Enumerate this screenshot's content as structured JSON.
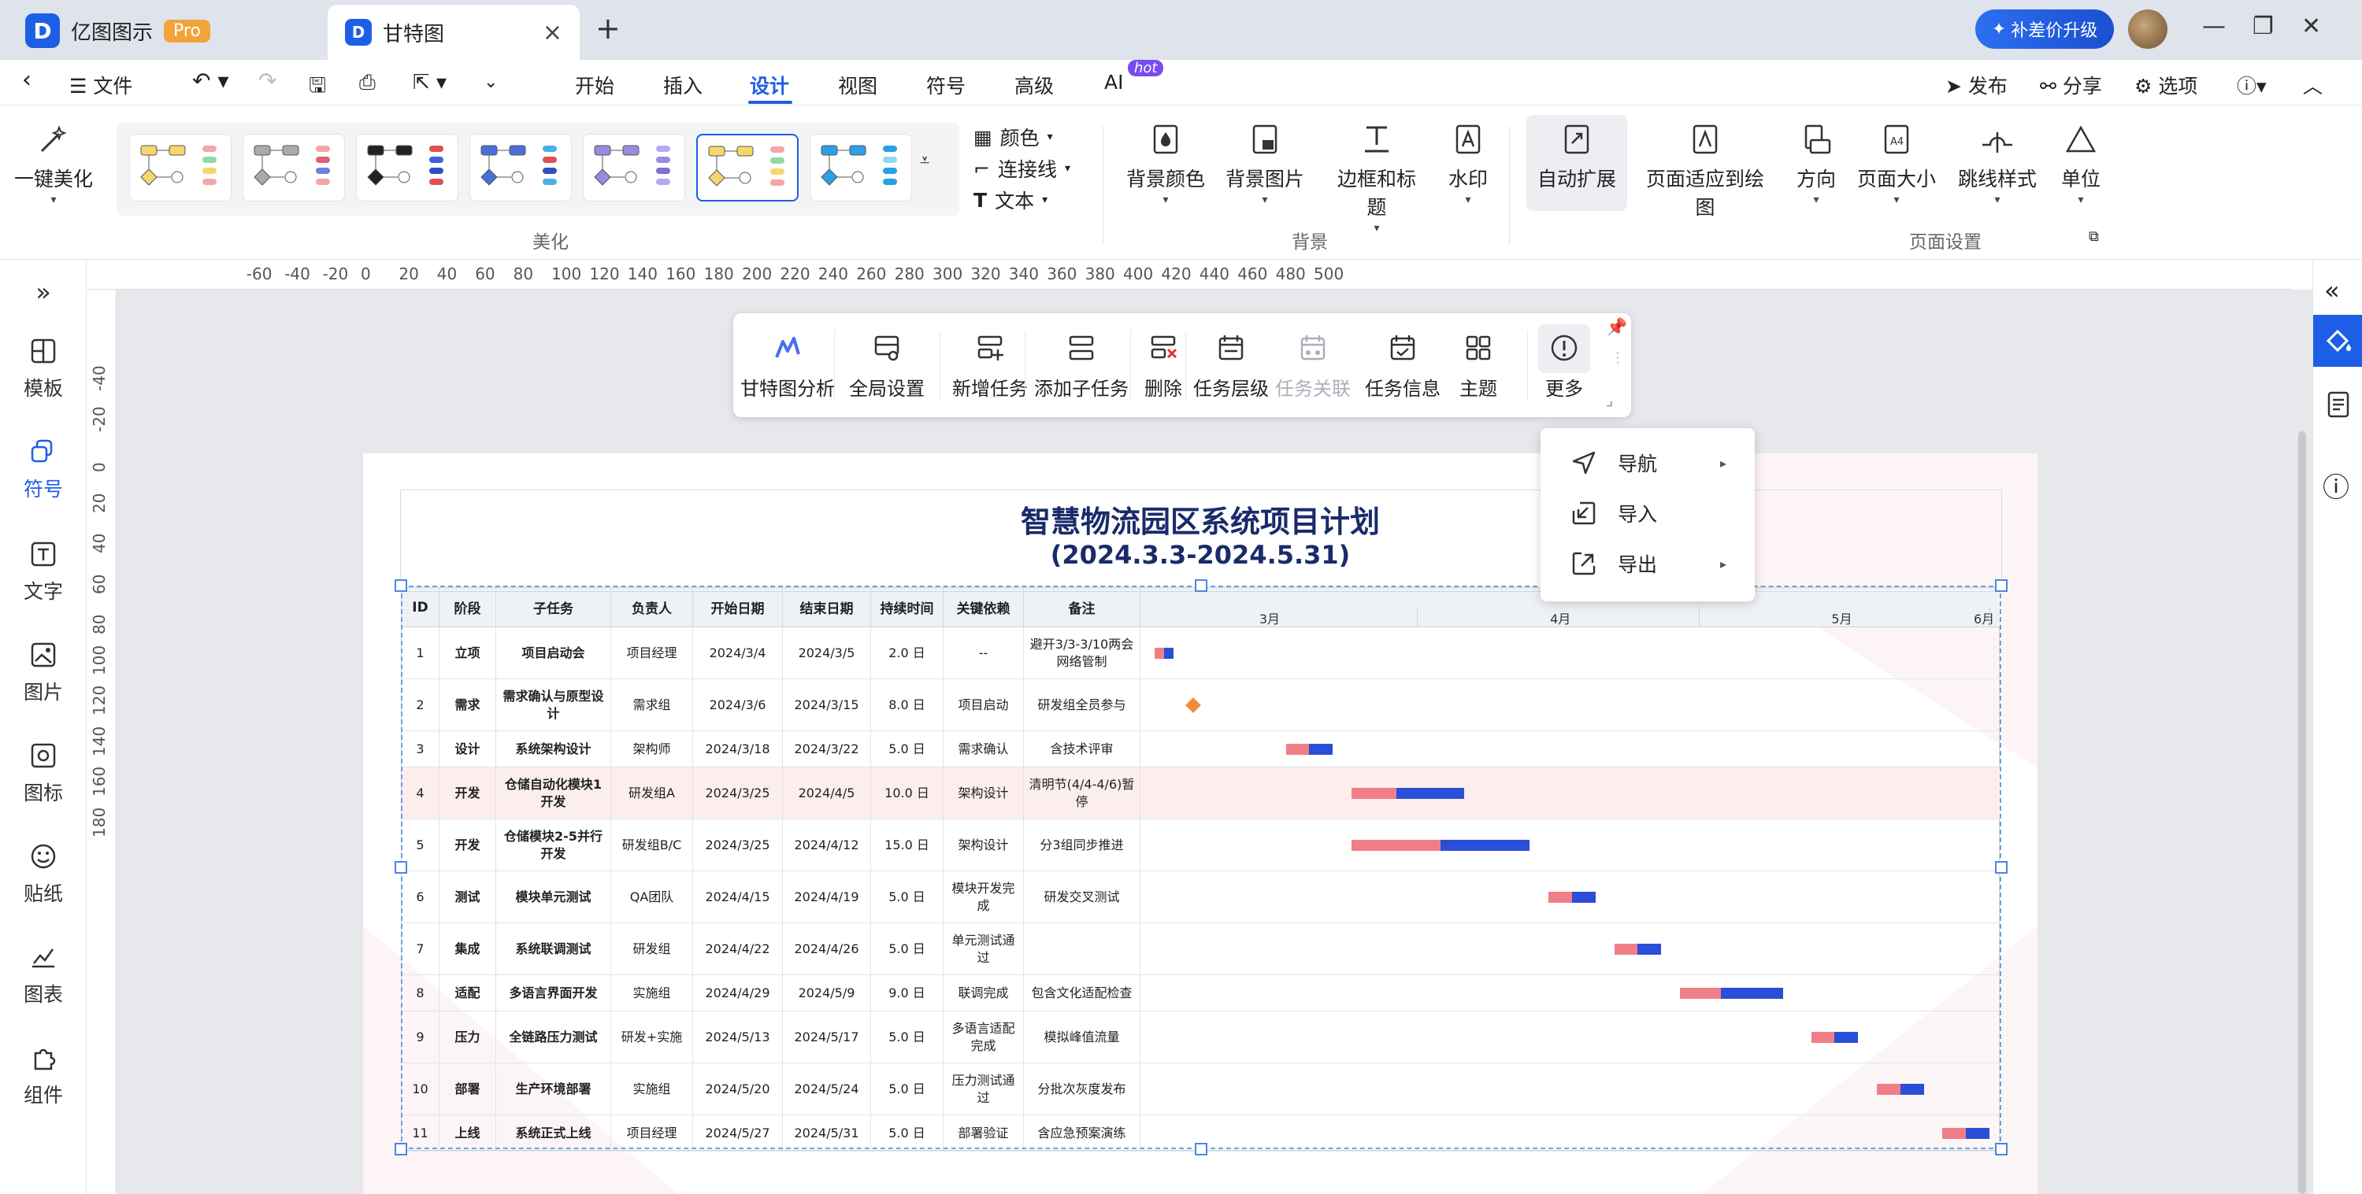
{
  "titlebar": {
    "app_name": "亿图图示",
    "pro_badge": "Pro",
    "doc_tab": "甘特图",
    "upgrade": "补差价升级"
  },
  "menubar": {
    "file": "文件",
    "items": [
      "开始",
      "插入",
      "设计",
      "视图",
      "符号",
      "高级",
      "AI"
    ],
    "active": "设计",
    "hot": "hot",
    "publish": "发布",
    "share": "分享",
    "options": "选项"
  },
  "ribbon": {
    "beautify": "一键美化",
    "group_beautify": "美化",
    "color": "颜色",
    "connector": "连接线",
    "text": "文本",
    "bg_color": "背景颜色",
    "bg_image": "背景图片",
    "border_title": "边框和标题",
    "watermark": "水印",
    "group_background": "背景",
    "auto_expand": "自动扩展",
    "fit_page": "页面适应到绘图",
    "orientation": "方向",
    "page_size": "页面大小",
    "jump_style": "跳线样式",
    "unit": "单位",
    "group_page": "页面设置"
  },
  "leftbar": [
    "模板",
    "符号",
    "文字",
    "图片",
    "图标",
    "贴纸",
    "图表",
    "组件"
  ],
  "hruler": [
    "-60",
    "-40",
    "-20",
    "0",
    "20",
    "40",
    "60",
    "80",
    "100",
    "120",
    "140",
    "160",
    "180",
    "200",
    "220",
    "240",
    "260",
    "280",
    "300",
    "320",
    "340",
    "360",
    "380",
    "400",
    "420",
    "440",
    "460",
    "480",
    "500"
  ],
  "vruler": [
    "-40",
    "-20",
    "0",
    "20",
    "40",
    "60",
    "80",
    "100",
    "120",
    "140",
    "160",
    "180"
  ],
  "float_toolbar": {
    "items": [
      "甘特图分析",
      "全局设置",
      "新增任务",
      "添加子任务",
      "删除",
      "任务层级",
      "任务关联",
      "任务信息",
      "主题",
      "更多"
    ],
    "disabled": "任务关联"
  },
  "dropdown": [
    "导航",
    "导入",
    "导出"
  ],
  "gantt": {
    "title": "智慧物流园区系统项目计划",
    "subtitle": "(2024.3.3-2024.5.31)",
    "columns": [
      "ID",
      "阶段",
      "子任务",
      "负责人",
      "开始日期",
      "结束日期",
      "持续时间",
      "关键依赖",
      "备注"
    ],
    "months": [
      "3月",
      "4月",
      "5月",
      "6月"
    ],
    "rows": [
      {
        "id": "1",
        "phase": "立项",
        "task": "项目启动会",
        "owner": "项目经理",
        "start": "2024/3/4",
        "end": "2024/3/5",
        "duration": "2.0 日",
        "dep": "--",
        "note": "避开3/3-3/10两会网络管制",
        "progress": 0.5
      },
      {
        "id": "2",
        "phase": "需求",
        "task": "需求确认与原型设计",
        "owner": "需求组",
        "start": "2024/3/6",
        "end": "2024/3/15",
        "duration": "8.0 日",
        "dep": "项目启动",
        "note": "研发组全员参与",
        "progress": 0
      },
      {
        "id": "3",
        "phase": "设计",
        "task": "系统架构设计",
        "owner": "架构师",
        "start": "2024/3/18",
        "end": "2024/3/22",
        "duration": "5.0 日",
        "dep": "需求确认",
        "note": "含技术评审",
        "progress": 0.5
      },
      {
        "id": "4",
        "phase": "开发",
        "task": "仓储自动化模块1开发",
        "owner": "研发组A",
        "start": "2024/3/25",
        "end": "2024/4/5",
        "duration": "10.0 日",
        "dep": "架构设计",
        "note": "清明节(4/4-4/6)暂停",
        "progress": 0.4
      },
      {
        "id": "5",
        "phase": "开发",
        "task": "仓储模块2-5并行开发",
        "owner": "研发组B/C",
        "start": "2024/3/25",
        "end": "2024/4/12",
        "duration": "15.0 日",
        "dep": "架构设计",
        "note": "分3组同步推进",
        "progress": 0.5
      },
      {
        "id": "6",
        "phase": "测试",
        "task": "模块单元测试",
        "owner": "QA团队",
        "start": "2024/4/15",
        "end": "2024/4/19",
        "duration": "5.0 日",
        "dep": "模块开发完成",
        "note": "研发交叉测试",
        "progress": 0.5
      },
      {
        "id": "7",
        "phase": "集成",
        "task": "系统联调测试",
        "owner": "研发组",
        "start": "2024/4/22",
        "end": "2024/4/26",
        "duration": "5.0 日",
        "dep": "单元测试通过",
        "note": "",
        "progress": 0.5
      },
      {
        "id": "8",
        "phase": "适配",
        "task": "多语言界面开发",
        "owner": "实施组",
        "start": "2024/4/29",
        "end": "2024/5/9",
        "duration": "9.0 日",
        "dep": "联调完成",
        "note": "包含文化适配检查",
        "progress": 0.4
      },
      {
        "id": "9",
        "phase": "压力",
        "task": "全链路压力测试",
        "owner": "研发+实施",
        "start": "2024/5/13",
        "end": "2024/5/17",
        "duration": "5.0 日",
        "dep": "多语言适配完成",
        "note": "模拟峰值流量",
        "progress": 0.5
      },
      {
        "id": "10",
        "phase": "部署",
        "task": "生产环境部署",
        "owner": "实施组",
        "start": "2024/5/20",
        "end": "2024/5/24",
        "duration": "5.0 日",
        "dep": "压力测试通过",
        "note": "分批次灰度发布",
        "progress": 0.5
      },
      {
        "id": "11",
        "phase": "上线",
        "task": "系统正式上线",
        "owner": "项目经理",
        "start": "2024/5/27",
        "end": "2024/5/31",
        "duration": "5.0 日",
        "dep": "部署验证",
        "note": "含应急预案演练",
        "progress": 0.5
      }
    ]
  },
  "colors": {
    "accent": "#1d5ee6",
    "bar_done": "#f07e87",
    "bar_remaining": "#2a4ed8",
    "milestone": "#f08b3a",
    "title": "#1a2b6b"
  }
}
